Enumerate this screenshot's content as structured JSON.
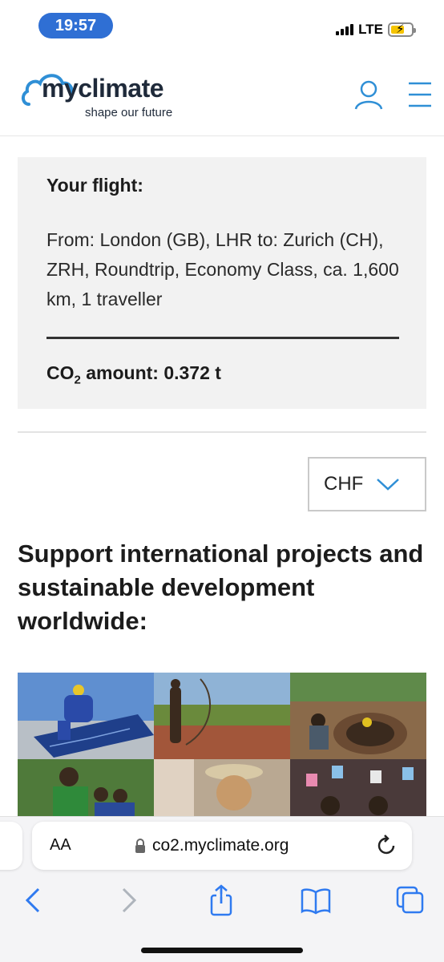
{
  "status_bar": {
    "time": "19:57",
    "network": "LTE",
    "icons": [
      "signal-icon",
      "battery-charging-icon"
    ]
  },
  "header": {
    "logo_name": "myclimate",
    "logo_tagline": "shape our future",
    "icons": [
      "user-icon",
      "menu-icon"
    ],
    "accent_color": "#2f8fd6"
  },
  "flight": {
    "title": "Your flight:",
    "description": "From: London (GB), LHR to: Zurich (CH), ZRH, Roundtrip, Economy Class, ca. 1,600 km, 1 traveller",
    "co2_prefix": "CO",
    "co2_sub": "2",
    "co2_rest": " amount: 0.372 t"
  },
  "currency": {
    "selected": "CHF",
    "icon": "chevron-down-icon"
  },
  "support": {
    "heading": "Support international projects and sustainable development worldwide:"
  },
  "photos": [
    "solar-panel-worker",
    "man-on-rock-landscape",
    "workers-building-pit",
    "children-group",
    "smiling-man-hat",
    "people-holding-cups"
  ],
  "browser": {
    "aa_label": "AA",
    "url": "co2.myclimate.org",
    "toolbar": [
      "back-icon",
      "forward-icon",
      "share-icon",
      "bookmarks-icon",
      "tabs-icon"
    ]
  }
}
